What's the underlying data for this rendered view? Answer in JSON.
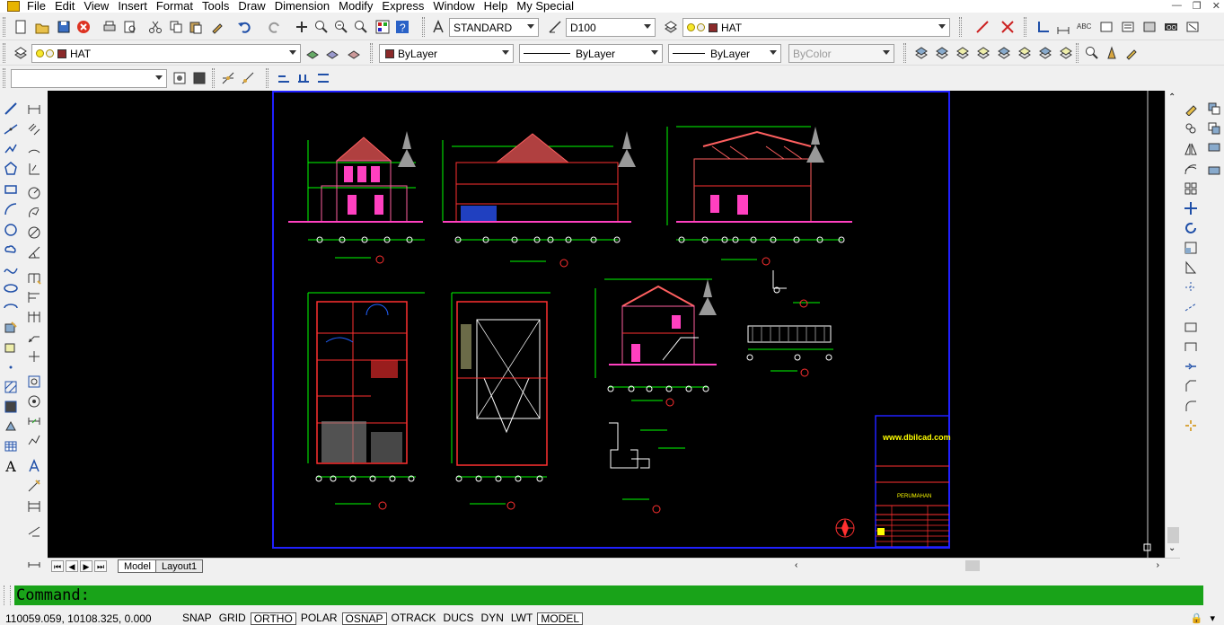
{
  "menu": [
    "File",
    "Edit",
    "View",
    "Insert",
    "Format",
    "Tools",
    "Draw",
    "Dimension",
    "Modify",
    "Express",
    "Window",
    "Help",
    "My Special"
  ],
  "toolbar": {
    "text_style": "STANDARD",
    "dim_style": "D100",
    "layer_current": "HAT",
    "layer_combo": "HAT",
    "color": "ByLayer",
    "linetype": "ByLayer",
    "lineweight": "ByLayer",
    "plotstyle": "ByColor",
    "view_combo": ""
  },
  "drawing": {
    "titleblock_website": "www.dbilcad.com",
    "titleblock_project": "PERUMAHAN"
  },
  "tabs": [
    "Model",
    "Layout1"
  ],
  "active_tab": "Model",
  "command": {
    "prompt": "Command:"
  },
  "status": {
    "coords": "110059.059, 10108.325, 0.000",
    "toggles": [
      {
        "label": "SNAP",
        "on": false
      },
      {
        "label": "GRID",
        "on": false
      },
      {
        "label": "ORTHO",
        "on": true
      },
      {
        "label": "POLAR",
        "on": false
      },
      {
        "label": "OSNAP",
        "on": true
      },
      {
        "label": "OTRACK",
        "on": false
      },
      {
        "label": "DUCS",
        "on": false
      },
      {
        "label": "DYN",
        "on": false
      },
      {
        "label": "LWT",
        "on": false
      },
      {
        "label": "MODEL",
        "on": true
      }
    ]
  },
  "colors": {
    "canvas": "#000000",
    "command_line": "#19a319",
    "layer_swatch": "#8b2a2a"
  }
}
